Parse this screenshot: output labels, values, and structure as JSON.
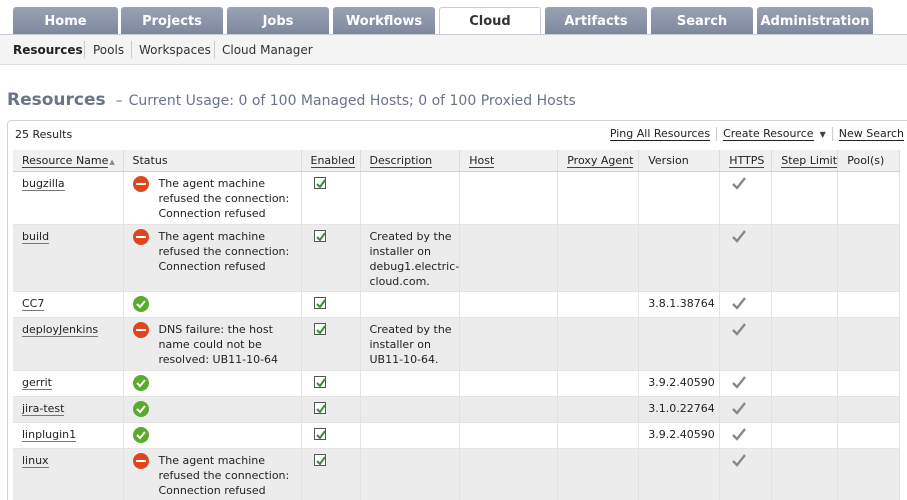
{
  "nav": {
    "tabs": [
      {
        "label": "Home"
      },
      {
        "label": "Projects"
      },
      {
        "label": "Jobs"
      },
      {
        "label": "Workflows"
      },
      {
        "label": "Cloud"
      },
      {
        "label": "Artifacts"
      },
      {
        "label": "Search"
      },
      {
        "label": "Administration"
      }
    ],
    "active_tab": "Cloud"
  },
  "subnav": {
    "items": [
      {
        "label": "Resources"
      },
      {
        "label": "Pools"
      },
      {
        "label": "Workspaces"
      },
      {
        "label": "Cloud Manager"
      }
    ],
    "active": "Resources"
  },
  "page": {
    "title": "Resources",
    "dash": "–",
    "usage": "Current Usage: 0 of 100 Managed Hosts; 0 of 100 Proxied Hosts"
  },
  "toolbar": {
    "results": "25 Results",
    "ping_all": "Ping All Resources",
    "create_resource": "Create Resource",
    "new_search": "New Search"
  },
  "table": {
    "columns": {
      "name": "Resource Name",
      "status": "Status",
      "enabled": "Enabled",
      "description": "Description",
      "host": "Host",
      "proxy": "Proxy Agent",
      "version": "Version",
      "https": "HTTPS",
      "step_limit": "Step Limit",
      "pools": "Pool(s)"
    },
    "sort_indicator": "▲",
    "rows": [
      {
        "name": "bugzilla",
        "status_icon": "error",
        "status": "The agent machine refused the connection: Connection refused",
        "enabled": true,
        "description": "",
        "host": "",
        "proxy": "",
        "version": "",
        "https": true,
        "step_limit": "",
        "pools": ""
      },
      {
        "name": "build",
        "status_icon": "error",
        "status": "The agent machine refused the connection: Connection refused",
        "enabled": true,
        "description": "Created by the installer on debug1.electric-cloud.com.",
        "host": "",
        "proxy": "",
        "version": "",
        "https": true,
        "step_limit": "",
        "pools": ""
      },
      {
        "name": "CC7",
        "status_icon": "ok",
        "status": "",
        "enabled": true,
        "description": "",
        "host": "",
        "proxy": "",
        "version": "3.8.1.38764",
        "https": true,
        "step_limit": "",
        "pools": ""
      },
      {
        "name": "deployJenkins",
        "status_icon": "error",
        "status": "DNS failure: the host name could not be resolved: UB11-10-64",
        "enabled": true,
        "description": "Created by the installer on UB11-10-64.",
        "host": "",
        "proxy": "",
        "version": "",
        "https": true,
        "step_limit": "",
        "pools": ""
      },
      {
        "name": "gerrit",
        "status_icon": "ok",
        "status": "",
        "enabled": true,
        "description": "",
        "host": "",
        "proxy": "",
        "version": "3.9.2.40590",
        "https": true,
        "step_limit": "",
        "pools": ""
      },
      {
        "name": "jira-test",
        "status_icon": "ok",
        "status": "",
        "enabled": true,
        "description": "",
        "host": "",
        "proxy": "",
        "version": "3.1.0.22764",
        "https": true,
        "step_limit": "",
        "pools": ""
      },
      {
        "name": "linplugin1",
        "status_icon": "ok",
        "status": "",
        "enabled": true,
        "description": "",
        "host": "",
        "proxy": "",
        "version": "3.9.2.40590",
        "https": true,
        "step_limit": "",
        "pools": ""
      },
      {
        "name": "linux",
        "status_icon": "error",
        "status": "The agent machine refused the connection: Connection refused",
        "enabled": true,
        "description": "",
        "host": "",
        "proxy": "",
        "version": "",
        "https": true,
        "step_limit": "",
        "pools": ""
      }
    ]
  },
  "colors": {
    "tab_bg": "#8a93a8",
    "title": "#6a7487",
    "error": "#e0461e",
    "ok": "#5aaa2c",
    "checkbox_check": "#3a8a3a",
    "https_check": "#888888"
  }
}
